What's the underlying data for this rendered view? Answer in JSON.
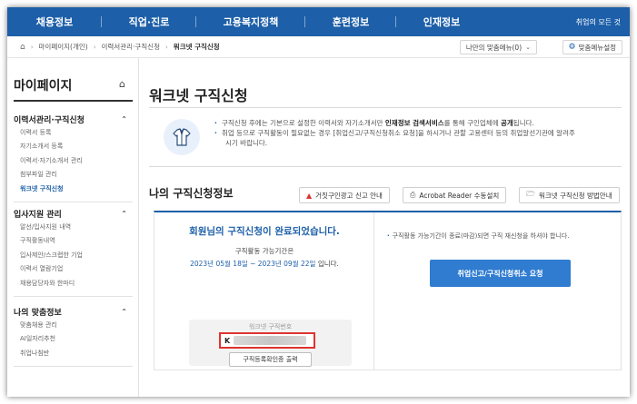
{
  "topnav": {
    "items": [
      "채용정보",
      "직업·진로",
      "고용복지정책",
      "훈련정보",
      "인재정보"
    ],
    "all_link": "취업의 모든 것"
  },
  "breadcrumb": {
    "home_icon": "home-icon",
    "items": [
      "마이페이지(개인)",
      "이력서관리·구직신청",
      "워크넷 구직신청"
    ],
    "my_menu": "나만의 맞춤메뉴(0)",
    "menu_settings": "맞춤메뉴설정"
  },
  "sidebar": {
    "title": "마이페이지",
    "sections": [
      {
        "heading": "이력서관리·구직신청",
        "items": [
          "이력서 등록",
          "자기소개서 등록",
          "이력서·자기소개서 관리",
          "첨부파일 관리",
          "워크넷 구직신청"
        ],
        "active_index": 4
      },
      {
        "heading": "입사지원 관리",
        "items": [
          "알선/입사지원 내역",
          "구직활동내역",
          "입사제안/스크랩한 기업",
          "이력서 열람기업",
          "채용담당자와 한마디"
        ]
      },
      {
        "heading": "나의 맞춤정보",
        "items": [
          "맞춤채용 관리",
          "AI일자리추천",
          "취업나침반"
        ]
      }
    ]
  },
  "main": {
    "title": "워크넷 구직신청",
    "notice": {
      "line1_pre": "구직신청 후에는 기본으로 설정한 이력서와 자기소개서만 ",
      "line1_bold1": "인재정보 검색서비스",
      "line1_mid": "를 통해 구인업체에 ",
      "line1_bold2": "공개",
      "line1_post": "됩니다.",
      "line2": "취업 등으로 구직활동이 필요없는 경우 [취업신고/구직신청취소 요청]을 하시거나 관할 고용센터 등의 취업알선기관에 알려주",
      "line3": "시기 바랍니다."
    },
    "section_title": "나의 구직신청정보",
    "buttons": {
      "report": "거짓구인광고 신고 안내",
      "acrobat": "Acrobat Reader 수동설치",
      "howto": "워크넷 구직신청 방법안내"
    },
    "status": {
      "headline": "회원님의 구직신청이 완료되었습니다.",
      "period_label": "구직활동 가능기간은",
      "period_dates": "2023년 05월 18일 ~ 2023년 09월 22일",
      "period_suffix": " 입니다.",
      "number_label": "워크넷 구직번호",
      "number_prefix": "K",
      "print_button": "구직등록확인증 출력",
      "right_note": "구직활동 가능기간이 종료(마감)되면 구직 재신청을 하셔야 합니다.",
      "cancel_button": "취업신고/구직신청취소 요청"
    }
  }
}
